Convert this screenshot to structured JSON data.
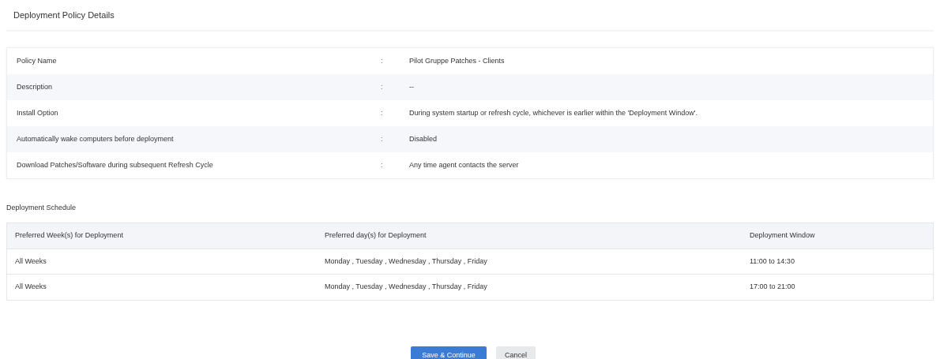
{
  "page_title": "Deployment Policy Details",
  "details": [
    {
      "label": "Policy Name",
      "separator": ":",
      "value": "Pilot Gruppe Patches - Clients"
    },
    {
      "label": "Description",
      "separator": ":",
      "value": "--"
    },
    {
      "label": "Install Option",
      "separator": ":",
      "value": "During system startup or refresh cycle, whichever is earlier within the 'Deployment Window'."
    },
    {
      "label": "Automatically wake computers before deployment",
      "separator": ":",
      "value": "Disabled"
    },
    {
      "label": "Download Patches/Software during subsequent Refresh Cycle",
      "separator": ":",
      "value": "Any time agent contacts the server"
    }
  ],
  "schedule": {
    "title": "Deployment Schedule",
    "columns": [
      "Preferred Week(s) for Deployment",
      "Preferred day(s) for Deployment",
      "Deployment Window"
    ],
    "rows": [
      [
        "All Weeks",
        "Monday , Tuesday , Wednesday , Thursday , Friday",
        "11:00 to 14:30"
      ],
      [
        "All Weeks",
        "Monday , Tuesday , Wednesday , Thursday , Friday",
        "17:00 to 21:00"
      ]
    ]
  },
  "buttons": [
    {
      "label": "Save & Continue",
      "kind": "primary"
    },
    {
      "label": "Cancel",
      "kind": "secondary"
    }
  ]
}
